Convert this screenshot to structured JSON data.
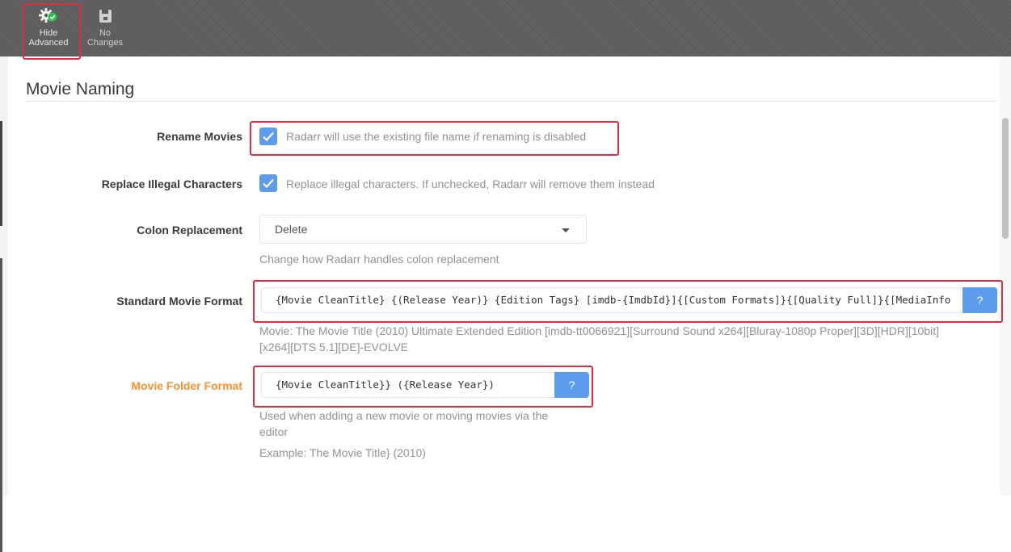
{
  "toolbar": {
    "advanced": {
      "label_line1": "Hide",
      "label_line2": "Advanced",
      "icon": "gear-check-icon"
    },
    "save": {
      "label_line1": "No",
      "label_line2": "Changes",
      "icon": "save-icon"
    }
  },
  "section": {
    "title": "Movie Naming"
  },
  "fields": {
    "rename_movies": {
      "label": "Rename Movies",
      "checked": true,
      "help": "Radarr will use the existing file name if renaming is disabled"
    },
    "replace_illegal": {
      "label": "Replace Illegal Characters",
      "checked": true,
      "help": "Replace illegal characters. If unchecked, Radarr will remove them instead"
    },
    "colon_replacement": {
      "label": "Colon Replacement",
      "value": "Delete",
      "help": "Change how Radarr handles colon replacement"
    },
    "standard_format": {
      "label": "Standard Movie Format",
      "value": "{Movie CleanTitle} {(Release Year)} {Edition Tags} [imdb-{ImdbId}]{[Custom Formats]}{[Quality Full]}{[MediaInfo",
      "help_button": "?",
      "example_line1": "Movie: The Movie Title (2010) Ultimate Extended Edition [imdb-tt0066921][Surround Sound x264][Bluray-1080p Proper][3D][HDR][10bit]",
      "example_line2": "[x264][DTS 5.1][DE]-EVOLVE"
    },
    "folder_format": {
      "label": "Movie Folder Format",
      "value": "{Movie CleanTitle}} ({Release Year})",
      "help_button": "?",
      "help_line1": "Used when adding a new movie or moving movies via the",
      "help_line2": "editor",
      "example": "Example: The Movie Title} (2010)"
    }
  },
  "colors": {
    "accent": "#5d9cec",
    "warning_label": "#ff902b",
    "highlight": "#d83040",
    "toolbar": "#5c5c5c"
  }
}
